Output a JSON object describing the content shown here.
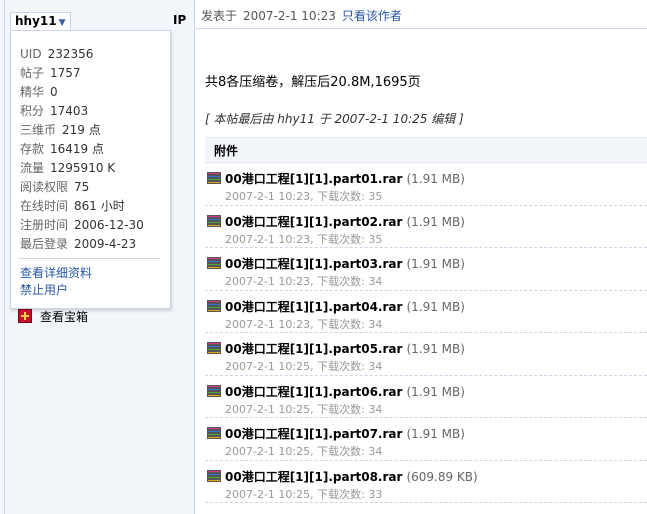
{
  "author": {
    "username": "hhy11",
    "ip_label": "IP"
  },
  "profile_stats": [
    {
      "key": "UID",
      "value": "232356"
    },
    {
      "key": "帖子",
      "value": "1757"
    },
    {
      "key": "精华",
      "value": "0"
    },
    {
      "key": "积分",
      "value": "17403"
    },
    {
      "key": "三维币",
      "value": "219 点"
    },
    {
      "key": "存款",
      "value": "16419 点"
    },
    {
      "key": "流量",
      "value": "1295910 K"
    },
    {
      "key": "阅读权限",
      "value": "75"
    },
    {
      "key": "在线时间",
      "value": "861 小时"
    },
    {
      "key": "注册时间",
      "value": "2006-12-30"
    },
    {
      "key": "最后登录",
      "value": "2009-4-23"
    }
  ],
  "profile_links": {
    "view_profile": "查看详细资料",
    "ban_user": "禁止用户"
  },
  "treasure_box": {
    "label": "查看宝箱"
  },
  "post": {
    "posted_label": "发表于",
    "posted_time": "2007-2-1 10:23",
    "author_only_label": "只看该作者",
    "summary": "共8各压缩卷，解压后20.8M,1695页",
    "edit_note": "[ 本帖最后由 hhy11 于 2007-2-1 10:25 编辑 ]",
    "attachments_label": "附件",
    "attachments": [
      {
        "name": "00港口工程[1][1].part01.rar",
        "size": "(1.91 MB)",
        "meta": "2007-2-1 10:23, 下载次数: 35"
      },
      {
        "name": "00港口工程[1][1].part02.rar",
        "size": "(1.91 MB)",
        "meta": "2007-2-1 10:23, 下载次数: 35"
      },
      {
        "name": "00港口工程[1][1].part03.rar",
        "size": "(1.91 MB)",
        "meta": "2007-2-1 10:23, 下载次数: 34"
      },
      {
        "name": "00港口工程[1][1].part04.rar",
        "size": "(1.91 MB)",
        "meta": "2007-2-1 10:23, 下载次数: 34"
      },
      {
        "name": "00港口工程[1][1].part05.rar",
        "size": "(1.91 MB)",
        "meta": "2007-2-1 10:25, 下载次数: 34"
      },
      {
        "name": "00港口工程[1][1].part06.rar",
        "size": "(1.91 MB)",
        "meta": "2007-2-1 10:25, 下载次数: 34"
      },
      {
        "name": "00港口工程[1][1].part07.rar",
        "size": "(1.91 MB)",
        "meta": "2007-2-1 10:25, 下载次数: 34"
      },
      {
        "name": "00港口工程[1][1].part08.rar",
        "size": "(609.89 KB)",
        "meta": "2007-2-1 10:25, 下载次数: 33"
      }
    ]
  }
}
